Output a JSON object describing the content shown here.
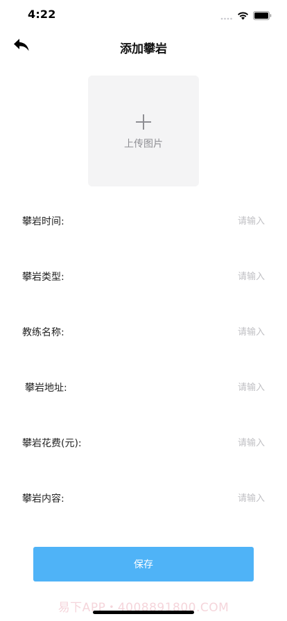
{
  "status_bar": {
    "time": "4:22"
  },
  "nav": {
    "title": "添加攀岩",
    "back_icon": "back-arrow-icon"
  },
  "upload": {
    "label": "上传图片",
    "icon": "plus-icon"
  },
  "form": {
    "fields": [
      {
        "label": "攀岩时间:",
        "placeholder": "请输入",
        "value": ""
      },
      {
        "label": "攀岩类型:",
        "placeholder": "请输入",
        "value": ""
      },
      {
        "label": "教练名称:",
        "placeholder": "请输入",
        "value": ""
      },
      {
        "label": "攀岩地址:",
        "placeholder": "请输入",
        "value": ""
      },
      {
        "label": "攀岩花费(元):",
        "placeholder": "请输入",
        "value": ""
      },
      {
        "label": "攀岩内容:",
        "placeholder": "请输入",
        "value": ""
      }
    ]
  },
  "actions": {
    "save_label": "保存"
  },
  "watermark": {
    "text": "易下APP・4008891800.COM"
  },
  "colors": {
    "accent": "#4fb3f7",
    "upload_bg": "#f4f4f5",
    "placeholder": "#c0c0c4",
    "watermark": "#f5d5db"
  }
}
